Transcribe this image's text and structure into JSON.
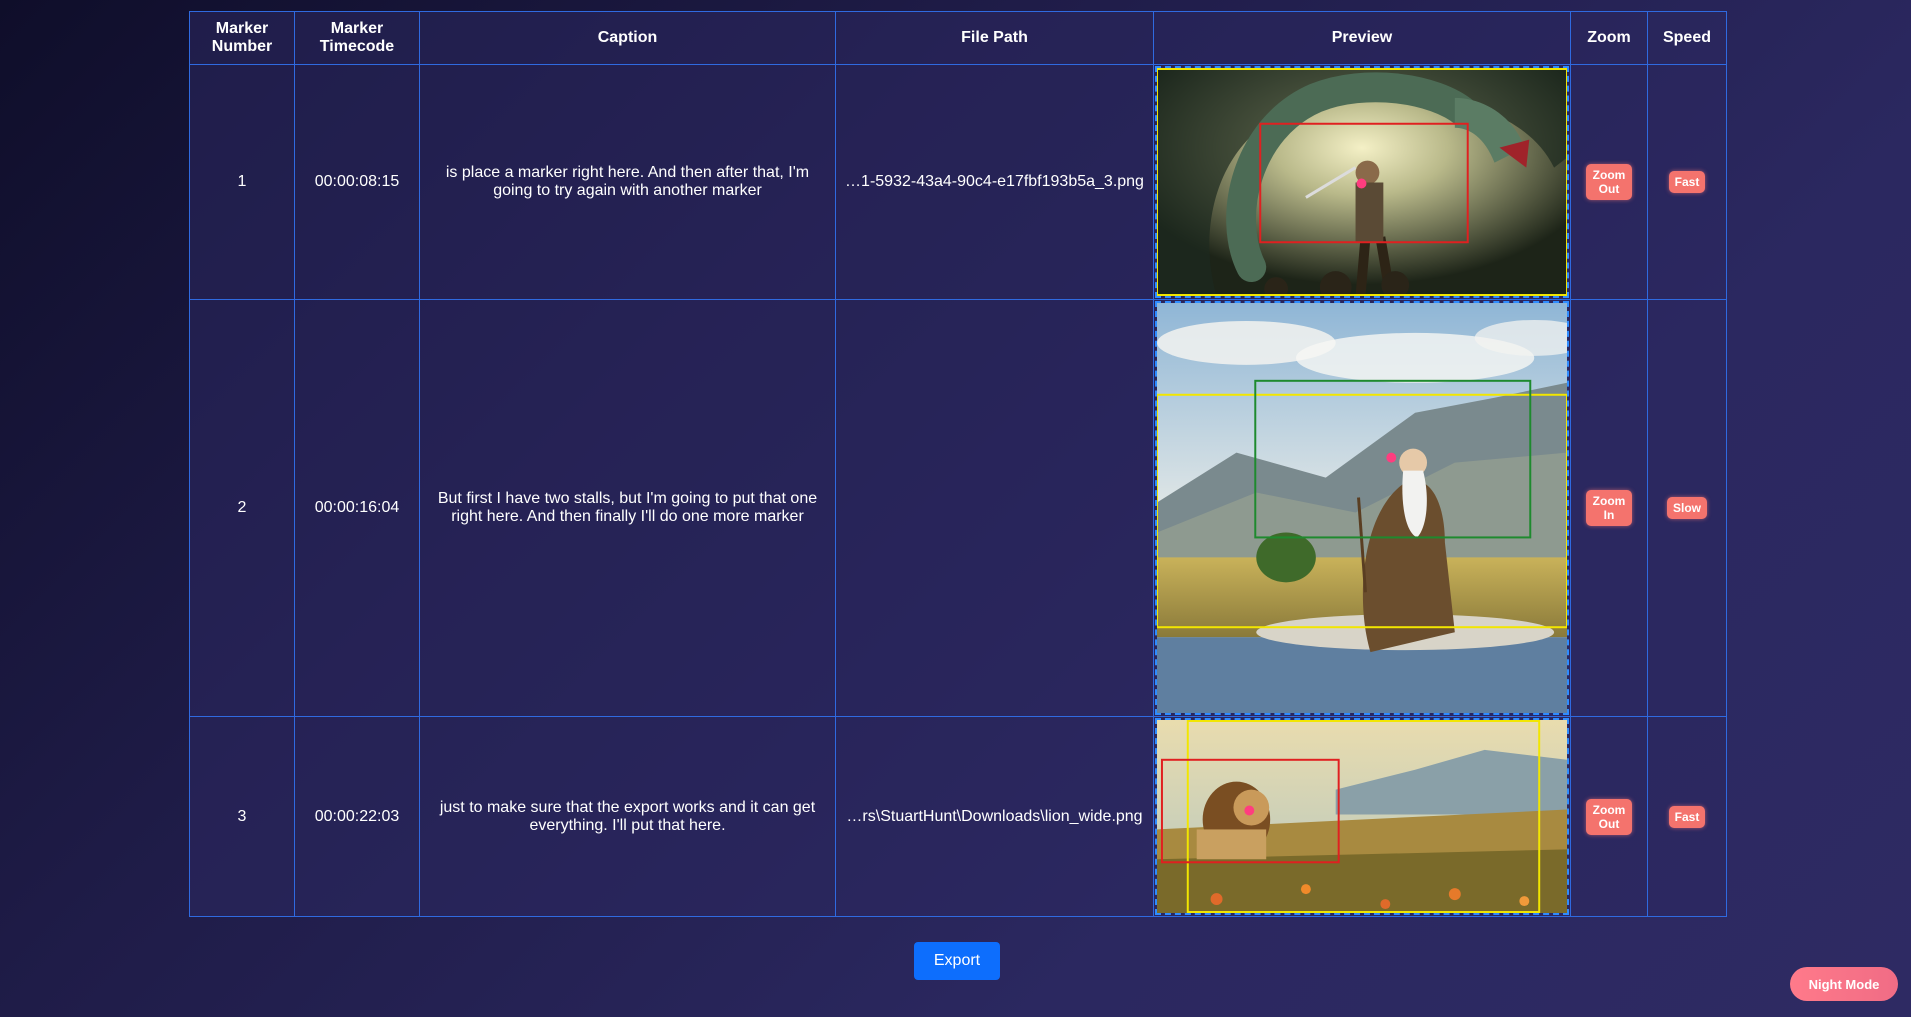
{
  "table": {
    "headers": {
      "marker_number": "Marker Number",
      "marker_timecode": "Marker Timecode",
      "caption": "Caption",
      "file_path": "File Path",
      "preview": "Preview",
      "zoom": "Zoom",
      "speed": "Speed"
    },
    "rows": [
      {
        "number": "1",
        "timecode": "00:00:08:15",
        "caption": "is place a marker right here. And then after that, I'm going to try again with another marker",
        "file_path": "…1-5932-43a4-90c4-e17fbf193b5a_3.png",
        "preview_subject": "warrior fighting a serpent",
        "zoom": "Zoom Out",
        "speed": "Fast"
      },
      {
        "number": "2",
        "timecode": "00:00:16:04",
        "caption": "But first I have two stalls, but I'm going to put that one right here. And then finally I'll do one more marker",
        "file_path": "",
        "preview_subject": "old man sitting by a lake",
        "zoom": "Zoom In",
        "speed": "Slow"
      },
      {
        "number": "3",
        "timecode": "00:00:22:03",
        "caption": "just to make sure that the export works and it can get everything. I'll put that here.",
        "file_path": "…rs\\StuartHunt\\Downloads\\lion_wide.png",
        "preview_subject": "lion in a meadow",
        "zoom": "Zoom Out",
        "speed": "Fast"
      }
    ]
  },
  "buttons": {
    "export_label": "Export",
    "night_mode_label": "Night Mode"
  },
  "colors": {
    "table_border": "#2f6ae0",
    "pill_bg": "#f4736d",
    "export_bg": "#0d6efd",
    "night_mode_bg": "#f06c85",
    "crop_red": "#e02020",
    "crop_yellow": "#f2e600",
    "crop_green": "#1e8a2e",
    "focus_dot": "#ff3d7f"
  }
}
